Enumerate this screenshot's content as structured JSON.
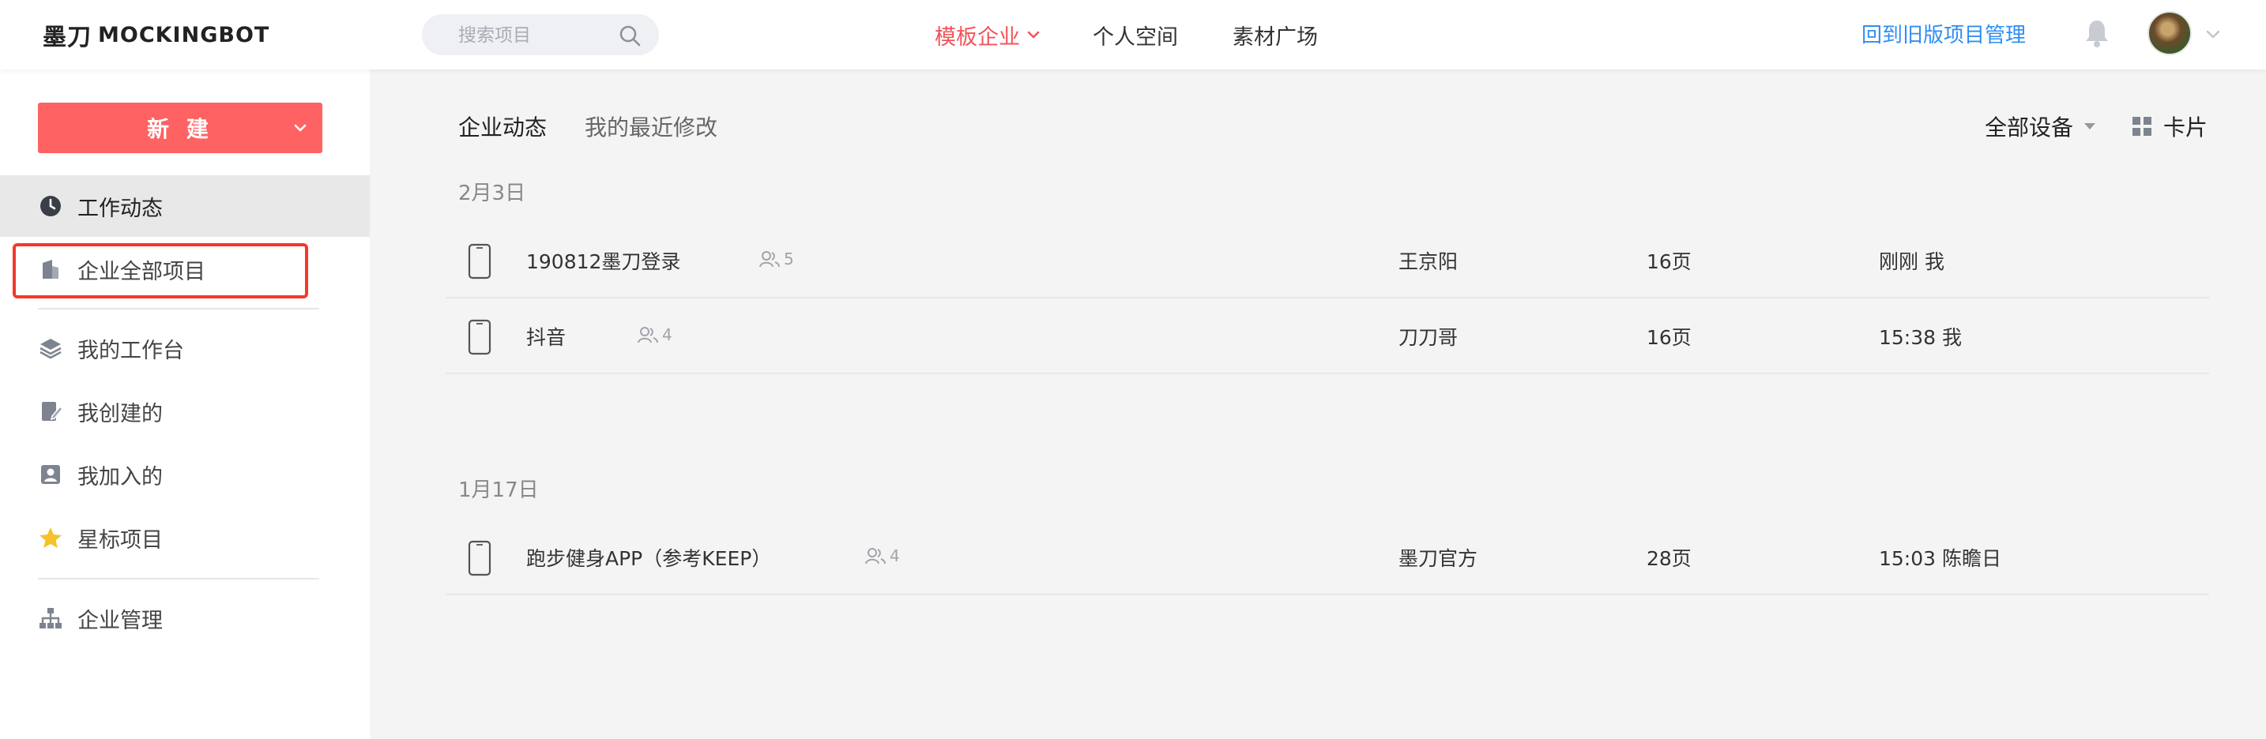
{
  "header": {
    "logo_cn": "墨刀",
    "logo_en": "MOCKINGBOT",
    "search_placeholder": "搜索项目",
    "nav": [
      {
        "label": "模板企业",
        "active": true
      },
      {
        "label": "个人空间",
        "active": false
      },
      {
        "label": "素材广场",
        "active": false
      }
    ],
    "old_version_link": "回到旧版项目管理",
    "icons": {
      "search": "search-icon",
      "bell": "bell-icon",
      "avatar": "avatar",
      "dropdown": "chevron-down-icon"
    }
  },
  "sidebar": {
    "new_button": "新 建",
    "items": [
      {
        "label": "工作动态",
        "icon": "clock-icon",
        "active": true
      },
      {
        "label": "企业全部项目",
        "icon": "building-icon",
        "active": false
      },
      {
        "label": "我的工作台",
        "icon": "layers-icon",
        "active": false
      },
      {
        "label": "我创建的",
        "icon": "edit-doc-icon",
        "active": false
      },
      {
        "label": "我加入的",
        "icon": "person-card-icon",
        "active": false
      },
      {
        "label": "星标项目",
        "icon": "star-icon",
        "active": false
      },
      {
        "label": "企业管理",
        "icon": "org-chart-icon",
        "active": false
      }
    ],
    "colors": {
      "new_button": "#ff6262",
      "star": "#f5c22b",
      "highlight_box": "#f5382a"
    }
  },
  "main": {
    "tabs": [
      {
        "label": "企业动态",
        "active": true
      },
      {
        "label": "我的最近修改",
        "active": false
      }
    ],
    "device_filter": "全部设备",
    "view_toggle": "卡片",
    "groups": [
      {
        "date": "2月3日",
        "rows": [
          {
            "name": "190812墨刀登录",
            "members": "5",
            "owner": "王京阳",
            "pages": "16页",
            "edited": "刚刚 我"
          },
          {
            "name": "抖音",
            "members": "4",
            "owner": "刀刀哥",
            "pages": "16页",
            "edited": "15:38 我"
          }
        ]
      },
      {
        "date": "1月17日",
        "rows": [
          {
            "name": "跑步健身APP（参考KEEP）",
            "members": "4",
            "owner": "墨刀官方",
            "pages": "28页",
            "edited": "15:03 陈瞻日"
          }
        ]
      }
    ]
  },
  "accent_color": "#f2545b",
  "link_color": "#2e8ef5"
}
